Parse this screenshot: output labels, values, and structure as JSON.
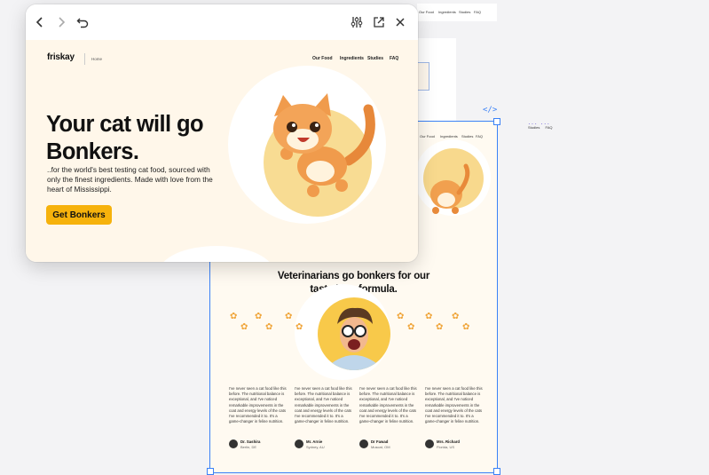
{
  "canvas": {
    "strip_nav": [
      "Our Food",
      "Ingredients",
      "Studies",
      "FAQ"
    ],
    "selection_labels": [
      "Studies",
      "FAQ"
    ],
    "code_icon_glyph": "</>"
  },
  "frame": {
    "nav": [
      "Our Food",
      "Ingredients",
      "Studies",
      "FAQ"
    ],
    "section_title_line1": "Veterinarians go bonkers for our",
    "section_title_line2": "tasty kitty formula.",
    "testimonials": [
      {
        "quote": "I've never seen a cat food like this before. The nutritional balance is exceptional, and I've noticed remarkable improvements in the coat and energy levels of the cats I've recommended it to. It's a game-changer in feline nutrition.",
        "name": "Dr. Sashira",
        "place": "Berlin, DE"
      },
      {
        "quote": "I've never seen a cat food like this before. The nutritional balance is exceptional, and I've noticed remarkable improvements in the coat and energy levels of the cats I've recommended it to. It's a game-changer in feline nutrition.",
        "name": "Mr. Arnie",
        "place": "Sydney, AU"
      },
      {
        "quote": "I've never seen a cat food like this before. The nutritional balance is exceptional, and I've noticed remarkable improvements in the coat and energy levels of the cats I've recommended it to. It's a game-changer in feline nutrition.",
        "name": "Dr Fawad",
        "place": "Muscat, OM"
      },
      {
        "quote": "I've never seen a cat food like this before. The nutritional balance is exceptional, and I've noticed remarkable improvements in the coat and energy levels of the cats I've recommended it to. It's a game-changer in feline nutrition.",
        "name": "Mrs. Richard",
        "place": "Florida, US"
      }
    ]
  },
  "window": {
    "toolbar_icons": [
      "back-icon",
      "forward-icon",
      "undo-icon",
      "sliders-icon",
      "open-external-icon",
      "close-icon"
    ],
    "site": {
      "logo": "friskay",
      "breadcrumb": "Home",
      "nav": [
        "Our Food",
        "Ingredients",
        "Studies",
        "FAQ"
      ],
      "headline_line1": "Your cat will go",
      "headline_line2": "Bonkers.",
      "subtext": "..for the world's best testing cat food, sourced with only the finest ingredients. Made with love from the heart of Mississippi.",
      "cta_label": "Get Bonkers"
    }
  },
  "colors": {
    "accent": "#f6b20c",
    "selection": "#3b82f6",
    "cream": "#fff7ea",
    "disc": "#f8dc93"
  }
}
